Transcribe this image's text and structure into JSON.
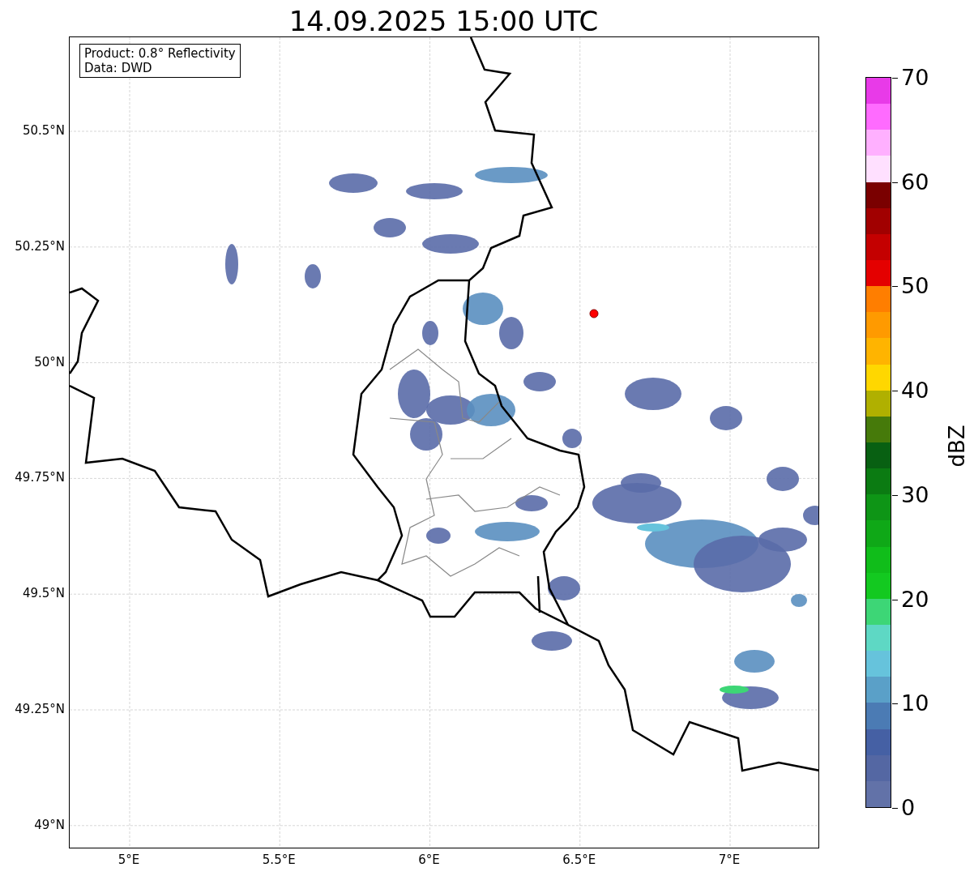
{
  "title": "14.09.2025 15:00 UTC",
  "info_box": [
    "Product: 0.8° Reflectivity",
    "Data: DWD"
  ],
  "map": {
    "x_ticks": [
      "5°E",
      "5.5°E",
      "6°E",
      "6.5°E",
      "7°E"
    ],
    "y_ticks": [
      "50.5°N",
      "50.25°N",
      "50°N",
      "49.75°N",
      "49.5°N",
      "49.25°N",
      "49°N"
    ]
  },
  "colorbar": {
    "label": "dBZ",
    "ticks": [
      "70",
      "60",
      "50",
      "40",
      "30",
      "20",
      "10",
      "0"
    ],
    "bands": [
      {
        "color": "#e83ae8"
      },
      {
        "color": "#ff6bff"
      },
      {
        "color": "#ffb0ff"
      },
      {
        "color": "#ffe0ff"
      },
      {
        "color": "#7a0000"
      },
      {
        "color": "#a10000"
      },
      {
        "color": "#c40000"
      },
      {
        "color": "#e40000"
      },
      {
        "color": "#ff7e00"
      },
      {
        "color": "#ff9a00"
      },
      {
        "color": "#ffb400"
      },
      {
        "color": "#ffd700"
      },
      {
        "color": "#b0b000"
      },
      {
        "color": "#467a0a"
      },
      {
        "color": "#086012"
      },
      {
        "color": "#0b7b12"
      },
      {
        "color": "#0e9516"
      },
      {
        "color": "#0fa817"
      },
      {
        "color": "#10bd1a"
      },
      {
        "color": "#13c920"
      },
      {
        "color": "#3dd676"
      },
      {
        "color": "#5ed8c4"
      },
      {
        "color": "#66c3dc"
      },
      {
        "color": "#5aa0c8"
      },
      {
        "color": "#4b7bb4"
      },
      {
        "color": "#4560a4"
      },
      {
        "color": "#5467a3"
      },
      {
        "color": "#6272a8"
      }
    ]
  }
}
